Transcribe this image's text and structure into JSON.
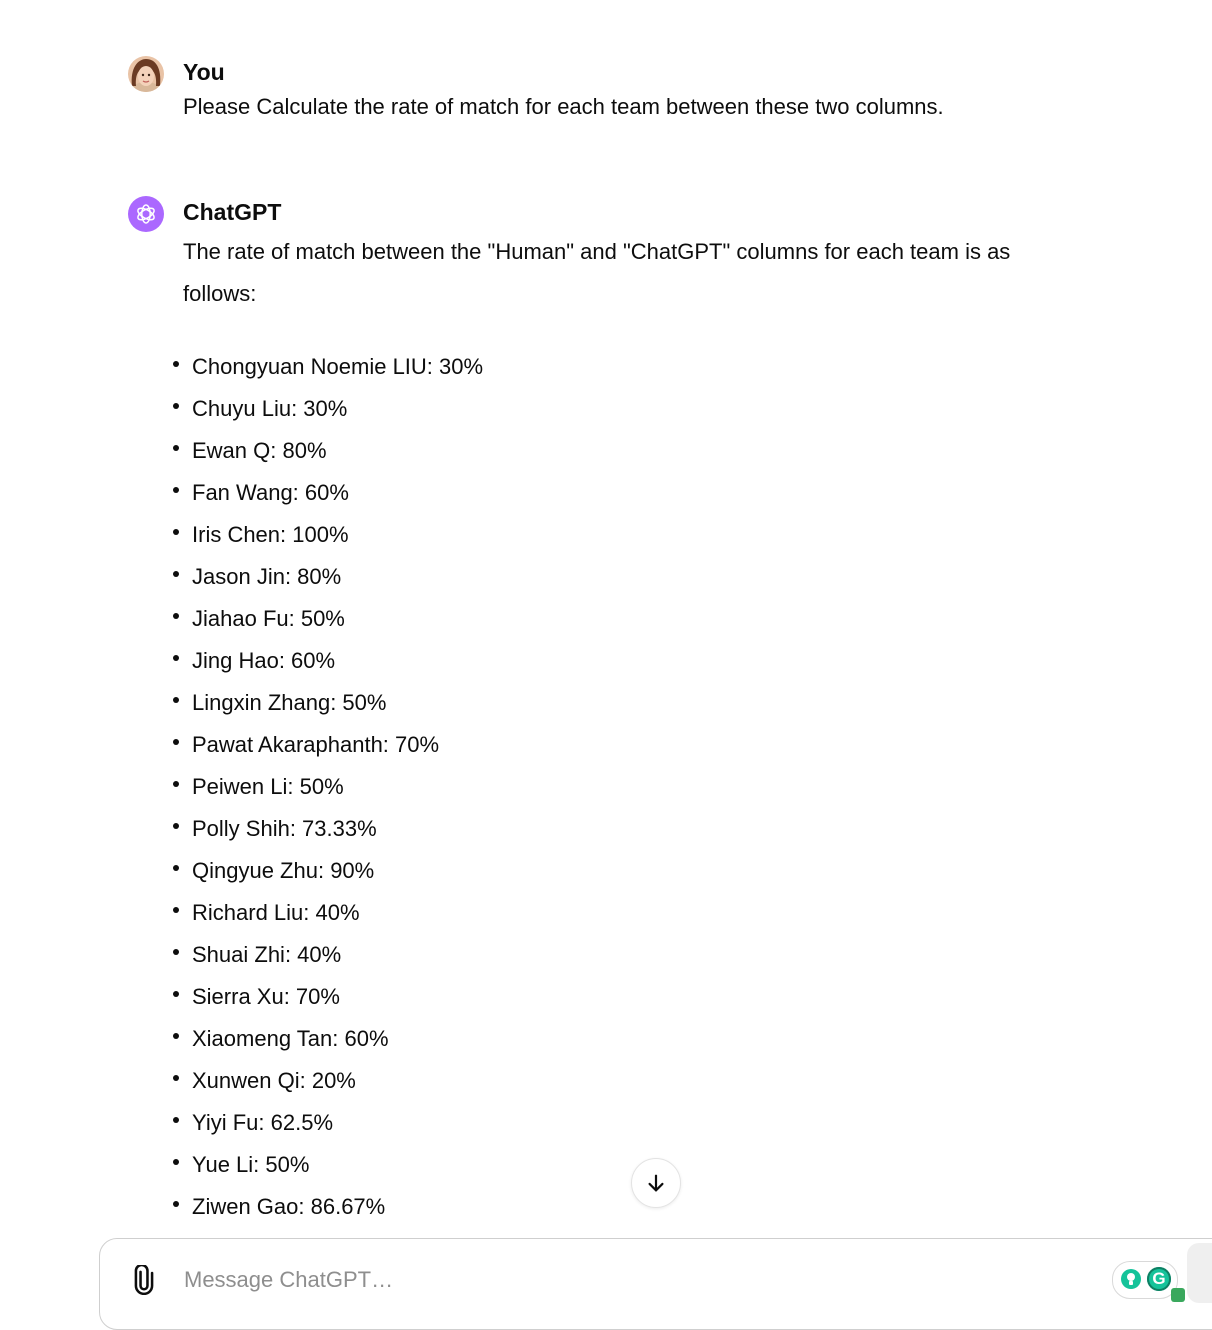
{
  "conversation": {
    "user_message": {
      "author": "You",
      "text": "Please Calculate the rate of match for each team between these two columns."
    },
    "assistant_message": {
      "author": "ChatGPT",
      "intro": "The rate of match between the \"Human\" and \"ChatGPT\" columns for each team is as follows:",
      "results": [
        "Chongyuan Noemie LIU: 30%",
        "Chuyu Liu: 30%",
        "Ewan Q: 80%",
        "Fan Wang: 60%",
        "Iris Chen: 100%",
        "Jason Jin: 80%",
        "Jiahao Fu: 50%",
        "Jing Hao: 60%",
        "Lingxin Zhang: 50%",
        "Pawat Akaraphanth: 70%",
        "Peiwen Li: 50%",
        "Polly Shih: 73.33%",
        "Qingyue Zhu: 90%",
        "Richard Liu: 40%",
        "Shuai Zhi: 40%",
        "Sierra Xu: 70%",
        "Xiaomeng Tan: 60%",
        "Xunwen Qi: 20%",
        "Yiyi Fu: 62.5%",
        "Yue Li: 50%",
        "Ziwen Gao: 86.67%"
      ]
    }
  },
  "composer": {
    "placeholder": "Message ChatGPT…",
    "value": ""
  },
  "icons": {
    "attach": "paperclip-icon",
    "scroll": "arrow-down-icon",
    "grammarly_bulb": "lightbulb-icon",
    "grammarly_logo": "G"
  },
  "colors": {
    "assistant_avatar": "#ab68ff",
    "grammarly": "#15c39a"
  }
}
